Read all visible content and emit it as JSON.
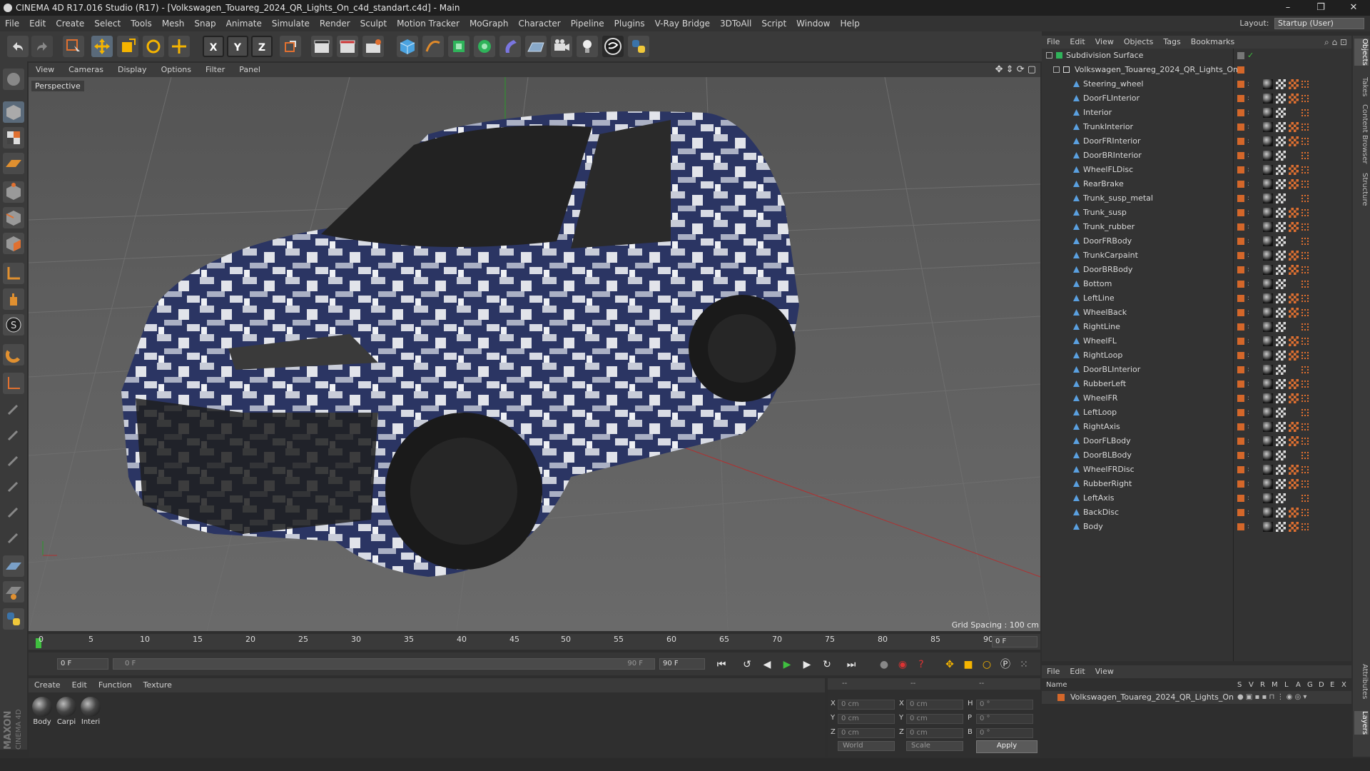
{
  "window": {
    "title": "CINEMA 4D R17.016 Studio (R17) - [Volkswagen_Touareg_2024_QR_Lights_On_c4d_standart.c4d] - Main",
    "minimize": "–",
    "restore": "❐",
    "close": "✕"
  },
  "menubar": [
    "File",
    "Edit",
    "Create",
    "Select",
    "Tools",
    "Mesh",
    "Snap",
    "Animate",
    "Simulate",
    "Render",
    "Sculpt",
    "Motion Tracker",
    "MoGraph",
    "Character",
    "Pipeline",
    "Plugins",
    "V-Ray Bridge",
    "3DToAll",
    "Script",
    "Window",
    "Help"
  ],
  "layout": {
    "label": "Layout:",
    "value": "Startup (User)"
  },
  "toolbar": {
    "x_axis": "X",
    "y_axis": "Y",
    "z_axis": "Z"
  },
  "viewport": {
    "menu": [
      "View",
      "Cameras",
      "Display",
      "Options",
      "Filter",
      "Panel"
    ],
    "label": "Perspective",
    "grid_spacing": "Grid Spacing : 100 cm"
  },
  "timeline": {
    "ticks": [
      "0",
      "5",
      "10",
      "15",
      "20",
      "25",
      "30",
      "35",
      "40",
      "45",
      "50",
      "55",
      "60",
      "65",
      "70",
      "75",
      "80",
      "85",
      "90"
    ],
    "current_frame": "0 F",
    "start_field": "0 F",
    "range_start": "0 F",
    "range_end": "90 F",
    "end_field": "90 F"
  },
  "material_manager": {
    "menu": [
      "Create",
      "Edit",
      "Function",
      "Texture"
    ],
    "materials": [
      "Body",
      "Carpi",
      "Interi"
    ]
  },
  "coordinates": {
    "header_left": "--",
    "header_mid": "--",
    "header_right": "--",
    "rows": [
      {
        "l1": "X",
        "v1": "0 cm",
        "l2": "X",
        "v2": "0 cm",
        "l3": "H",
        "v3": "0 °"
      },
      {
        "l1": "Y",
        "v1": "0 cm",
        "l2": "Y",
        "v2": "0 cm",
        "l3": "P",
        "v3": "0 °"
      },
      {
        "l1": "Z",
        "v1": "0 cm",
        "l2": "Z",
        "v2": "0 cm",
        "l3": "B",
        "v3": "0 °"
      }
    ],
    "mode": "World",
    "transform": "Scale",
    "apply": "Apply"
  },
  "object_manager": {
    "menu": [
      "File",
      "Edit",
      "View",
      "Objects",
      "Tags",
      "Bookmarks"
    ],
    "root": "Subdivision Surface",
    "group": "Volkswagen_Touareg_2024_QR_Lights_On",
    "objects": [
      "Steering_wheel",
      "DoorFLInterior",
      "Interior",
      "TrunkInterior",
      "DoorFRInterior",
      "DoorBRInterior",
      "WheelFLDisc",
      "RearBrake",
      "Trunk_susp_metal",
      "Trunk_susp",
      "Trunk_rubber",
      "DoorFRBody",
      "TrunkCarpaint",
      "DoorBRBody",
      "Bottom",
      "LeftLine",
      "WheelBack",
      "RightLine",
      "WheelFL",
      "RightLoop",
      "DoorBLInterior",
      "RubberLeft",
      "WheelFR",
      "LeftLoop",
      "RightAxis",
      "DoorFLBody",
      "DoorBLBody",
      "WheelFRDisc",
      "RubberRight",
      "LeftAxis",
      "BackDisc",
      "Body"
    ]
  },
  "layer_manager": {
    "menu": [
      "File",
      "Edit",
      "View"
    ],
    "columns": [
      "Name",
      "S",
      "V",
      "R",
      "M",
      "L",
      "A",
      "G",
      "D",
      "E",
      "X"
    ],
    "layer": "Volkswagen_Touareg_2024_QR_Lights_On"
  },
  "right_tabs": [
    "Objects",
    "Takes",
    "Content Browser",
    "Structure",
    "Attributes",
    "Layers"
  ],
  "branding": {
    "maxon": "MAXON",
    "product": "CINEMA 4D"
  },
  "colors": {
    "accent": "#d4672a",
    "car_blue": "#2b3563",
    "viewport_bg": "#5e5e5e"
  }
}
